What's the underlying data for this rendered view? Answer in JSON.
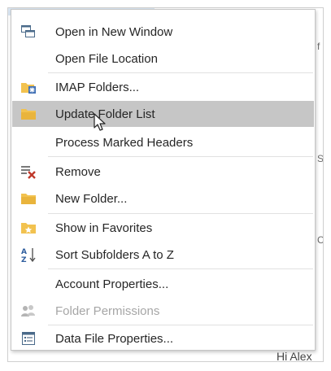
{
  "menu": {
    "items": [
      {
        "label": "Open in New Window",
        "icon": "new-window-icon",
        "enabled": true
      },
      {
        "label": "Open File Location",
        "icon": "",
        "enabled": true
      },
      {
        "label": "IMAP Folders...",
        "icon": "imap-folders-icon",
        "enabled": true
      },
      {
        "label": "Update Folder List",
        "icon": "folder-icon",
        "enabled": true,
        "highlighted": true
      },
      {
        "label": "Process Marked Headers",
        "icon": "",
        "enabled": true
      },
      {
        "label": "Remove",
        "icon": "remove-icon",
        "enabled": true
      },
      {
        "label": "New Folder...",
        "icon": "folder-icon",
        "enabled": true
      },
      {
        "label": "Show in Favorites",
        "icon": "favorites-icon",
        "enabled": true
      },
      {
        "label": "Sort Subfolders A to Z",
        "icon": "sort-az-icon",
        "enabled": true
      },
      {
        "label": "Account Properties...",
        "icon": "",
        "enabled": true
      },
      {
        "label": "Folder Permissions",
        "icon": "permissions-icon",
        "enabled": false
      },
      {
        "label": "Data File Properties...",
        "icon": "data-file-icon",
        "enabled": true
      }
    ]
  },
  "background": {
    "bottom_text": "Hi Alex"
  },
  "colors": {
    "highlight": "#c6c6c6",
    "folder": "#f2c24f",
    "remove_x": "#c0392b",
    "text": "#262626",
    "disabled_text": "#a6a6a6"
  }
}
